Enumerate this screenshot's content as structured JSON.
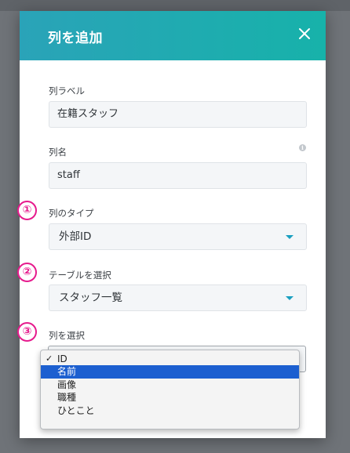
{
  "dialog": {
    "title": "列を追加"
  },
  "fields": {
    "column_label": {
      "label": "列ラベル",
      "value": "在籍スタッフ"
    },
    "column_name": {
      "label": "列名",
      "value": "staff",
      "info_icon": "info-icon"
    },
    "column_type": {
      "label": "列のタイプ",
      "value": "外部ID",
      "marker": "①"
    },
    "table_select": {
      "label": "テーブルを選択",
      "value": "スタッフ一覧",
      "marker": "②"
    },
    "column_select": {
      "label": "列を選択",
      "marker": "③"
    }
  },
  "dropdown": {
    "options": [
      {
        "label": "ID",
        "checked": true,
        "highlighted": false
      },
      {
        "label": "名前",
        "checked": false,
        "highlighted": true
      },
      {
        "label": "画像",
        "checked": false,
        "highlighted": false
      },
      {
        "label": "職種",
        "checked": false,
        "highlighted": false
      },
      {
        "label": "ひとこと",
        "checked": false,
        "highlighted": false
      }
    ],
    "check_glyph": "✓"
  },
  "colors": {
    "header_start": "#2aa3b8",
    "header_end": "#17b2aa",
    "caret": "#1a9fc0",
    "marker": "#e61a8d",
    "highlight": "#1c5fd0"
  }
}
